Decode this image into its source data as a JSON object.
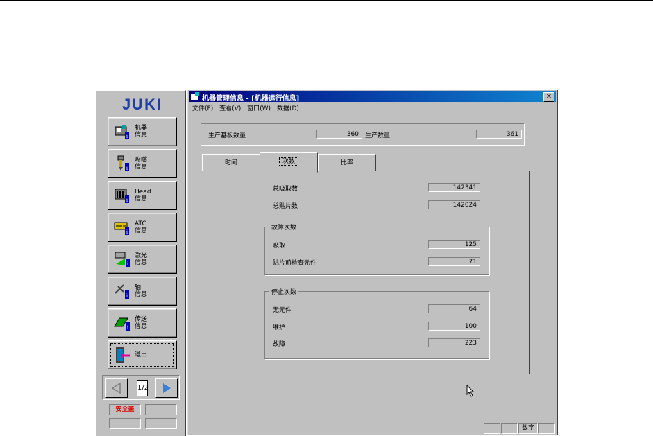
{
  "brand": {
    "logo_text": "JUKI",
    "color": "#1f3fa8"
  },
  "launcher": {
    "buttons": [
      {
        "label": "机器\n信息",
        "icon": "machine-info-icon"
      },
      {
        "label": "吸嘴\n信息",
        "icon": "nozzle-info-icon"
      },
      {
        "label": "Head\n信息",
        "icon": "head-info-icon"
      },
      {
        "label": "ATC\n信息",
        "icon": "atc-info-icon"
      },
      {
        "label": "激光\n信息",
        "icon": "laser-info-icon"
      },
      {
        "label": "轴\n信息",
        "icon": "axis-info-icon"
      },
      {
        "label": "传送\n信息",
        "icon": "conveyor-info-icon"
      },
      {
        "label": "退出",
        "icon": "exit-door-icon"
      }
    ],
    "page_indicator": "1/2",
    "safety_status": "安全盖"
  },
  "window": {
    "title": "机器管理信息 - [机器运行信息]",
    "menu": [
      "文件(F)",
      "查看(V)",
      "窗口(W)",
      "数据(D)"
    ],
    "summary": {
      "board_count_label": "生产基板数量",
      "board_count_value": "360",
      "production_count_label": "生产数量",
      "production_count_value": "361"
    },
    "tabs": [
      {
        "label": "时间",
        "active": false
      },
      {
        "label": "次数",
        "active": true
      },
      {
        "label": "比率",
        "active": false
      }
    ],
    "counts": {
      "total_pick_label": "总吸取数",
      "total_pick_value": "142341",
      "total_mount_label": "总贴片数",
      "total_mount_value": "142024"
    },
    "error_group": {
      "title": "故障次数",
      "rows": [
        {
          "label": "吸取",
          "value": "125"
        },
        {
          "label": "贴片前检查元件",
          "value": "71"
        }
      ]
    },
    "stop_group": {
      "title": "停止次数",
      "rows": [
        {
          "label": "无元件",
          "value": "64"
        },
        {
          "label": "维护",
          "value": "100"
        },
        {
          "label": "故障",
          "value": "223"
        }
      ]
    },
    "statusbar": {
      "mode": "数字"
    }
  }
}
